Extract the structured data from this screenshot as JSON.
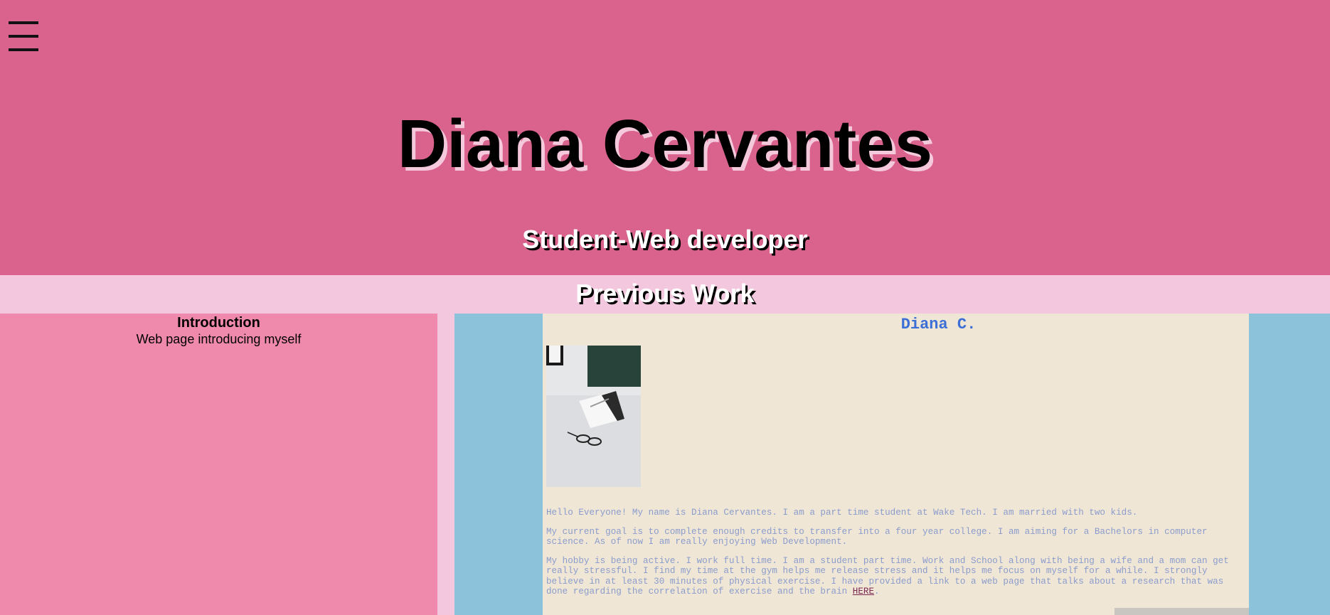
{
  "header": {
    "menu_icon": "hamburger-menu-icon",
    "title": "Diana Cervantes",
    "subtitle": "Student-Web developer",
    "bg_color": "#d9638c"
  },
  "section": {
    "title": "Previous Work",
    "bg_color": "#f3c8df"
  },
  "cards": [
    {
      "title": "Introduction",
      "description": "Web page introducing myself",
      "bg_color": "#f08aad"
    }
  ],
  "preview": {
    "heading": "Diana C.",
    "paragraph1": "Hello Everyone! My name is Diana Cervantes. I am a part time student at Wake Tech. I am married with two kids.",
    "paragraph2": "My current goal is to complete enough credits to transfer into a four year college. I am aiming for a Bachelors in computer science. As of now I am really enjoying Web Development.",
    "paragraph3": "My hobby is being active. I work full time. I am a student part time. Work and School along with being a wife and a mom can get really stressful. I find my time at the gym helps me release stress and it helps me focus on myself for a while. I strongly believe in at least 30 minutes of physical exercise. I have provided a link to a web page that talks about a research that was done regarding the correlation of exercise and the brain",
    "link_text": "HERE",
    "trailing": ".",
    "outer_bg": "#8cc3db",
    "page_bg": "#f0e6d6"
  }
}
